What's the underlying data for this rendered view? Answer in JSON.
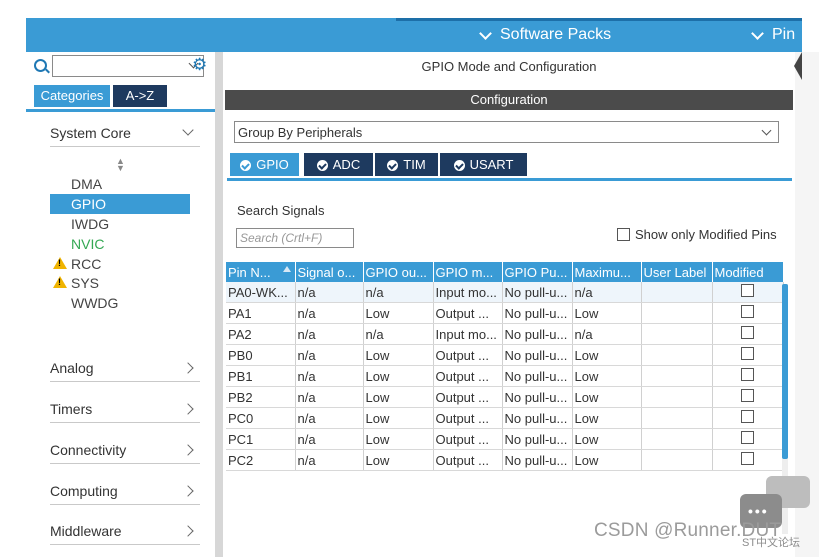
{
  "topbar": {
    "software_packs": "Software Packs",
    "pinout": "Pin"
  },
  "left": {
    "tabs": {
      "categories": "Categories",
      "az": "A->Z"
    },
    "system_core": {
      "label": "System Core",
      "items": [
        {
          "label": "DMA",
          "state": "normal"
        },
        {
          "label": "GPIO",
          "state": "selected"
        },
        {
          "label": "IWDG",
          "state": "normal"
        },
        {
          "label": "NVIC",
          "state": "green"
        },
        {
          "label": "RCC",
          "state": "warning"
        },
        {
          "label": "SYS",
          "state": "warning"
        },
        {
          "label": "WWDG",
          "state": "normal"
        }
      ]
    },
    "categories": [
      "Analog",
      "Timers",
      "Connectivity",
      "Computing",
      "Middleware"
    ]
  },
  "right": {
    "title": "GPIO Mode and Configuration",
    "config_bar": "Configuration",
    "group_select": "Group By Peripherals",
    "peripheral_tabs": [
      "GPIO",
      "ADC",
      "TIM",
      "USART"
    ],
    "search_label": "Search Signals",
    "search_placeholder": "Search (Crtl+F)",
    "show_modified": "Show only Modified Pins",
    "table": {
      "headers": [
        "Pin N...",
        "Signal o...",
        "GPIO ou...",
        "GPIO m...",
        "GPIO Pu...",
        "Maximu...",
        "User Label",
        "Modified"
      ],
      "rows": [
        [
          "PA0-WK...",
          "n/a",
          "n/a",
          "Input mo...",
          "No pull-u...",
          "n/a",
          ""
        ],
        [
          "PA1",
          "n/a",
          "Low",
          "Output ...",
          "No pull-u...",
          "Low",
          ""
        ],
        [
          "PA2",
          "n/a",
          "n/a",
          "Input mo...",
          "No pull-u...",
          "n/a",
          ""
        ],
        [
          "PB0",
          "n/a",
          "Low",
          "Output ...",
          "No pull-u...",
          "Low",
          ""
        ],
        [
          "PB1",
          "n/a",
          "Low",
          "Output ...",
          "No pull-u...",
          "Low",
          ""
        ],
        [
          "PB2",
          "n/a",
          "Low",
          "Output ...",
          "No pull-u...",
          "Low",
          ""
        ],
        [
          "PC0",
          "n/a",
          "Low",
          "Output ...",
          "No pull-u...",
          "Low",
          ""
        ],
        [
          "PC1",
          "n/a",
          "Low",
          "Output ...",
          "No pull-u...",
          "Low",
          ""
        ],
        [
          "PC2",
          "n/a",
          "Low",
          "Output ...",
          "No pull-u...",
          "Low",
          ""
        ]
      ]
    }
  },
  "watermark": {
    "main": "CSDN @Runner.DUT",
    "sub": "ST中文论坛"
  },
  "colors": {
    "accent": "#3a9bd5",
    "dark_tab": "#1e3a5f",
    "config_bar": "#4b4b4b",
    "nvic_green": "#34a853",
    "warning": "#f0b400"
  }
}
